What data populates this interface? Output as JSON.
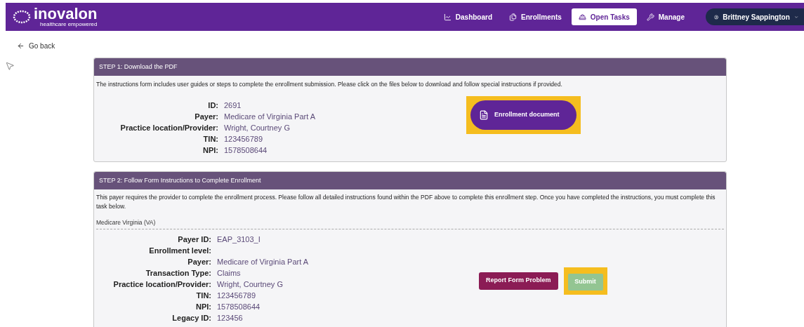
{
  "header": {
    "logo": {
      "name": "inovalon",
      "tagline": "healthcare empowered"
    },
    "nav": [
      {
        "label": "Dashboard",
        "selected": false
      },
      {
        "label": "Enrollments",
        "selected": false
      },
      {
        "label": "Open Tasks",
        "selected": true
      },
      {
        "label": "Manage",
        "selected": false
      }
    ],
    "user": {
      "name": "Brittney Sappington"
    }
  },
  "back_link": "Go back",
  "step1": {
    "title": "STEP 1: Download the PDF",
    "description": "The instructions form includes user guides or steps to complete the enrollment submission. Please click on the files below to download and follow special instructions if provided.",
    "fields": [
      {
        "label": "ID:",
        "value": "2691"
      },
      {
        "label": "Payer:",
        "value": "Medicare of Virginia Part A"
      },
      {
        "label": "Practice location/Provider:",
        "value": "Wright, Courtney G"
      },
      {
        "label": "TIN:",
        "value": "123456789"
      },
      {
        "label": "NPI:",
        "value": "1578508644"
      }
    ],
    "document_button": {
      "label": "Enrollment document",
      "highlighted": true
    }
  },
  "step2": {
    "title": "STEP 2: Follow Form Instructions to Complete Enrollment",
    "description": "This payer requires the provider to complete the enrollment process. Please follow all detailed instructions found within the PDF above to complete this enrollment step. Once you have completed the instructions, you must complete this task below.",
    "section_title": "Medicare Virginia (VA)",
    "fields": [
      {
        "label": "Payer ID:",
        "value": "EAP_3103_I"
      },
      {
        "label": "Enrollment level:"
      },
      {
        "label": "Payer:",
        "value": "Medicare of Virginia Part A"
      },
      {
        "label": "Transaction Type:",
        "value": "Claims"
      },
      {
        "label": "Practice location/Provider:",
        "value": "Wright, Courtney G"
      },
      {
        "label": "TIN:",
        "value": "123456789"
      },
      {
        "label": "NPI:",
        "value": "1578508644"
      },
      {
        "label": "Legacy ID:",
        "value": "123456"
      }
    ],
    "report_button": {
      "label": "Report Form Problem"
    },
    "submit_button": {
      "label": "Submit",
      "disabled": true,
      "highlighted": true
    }
  }
}
